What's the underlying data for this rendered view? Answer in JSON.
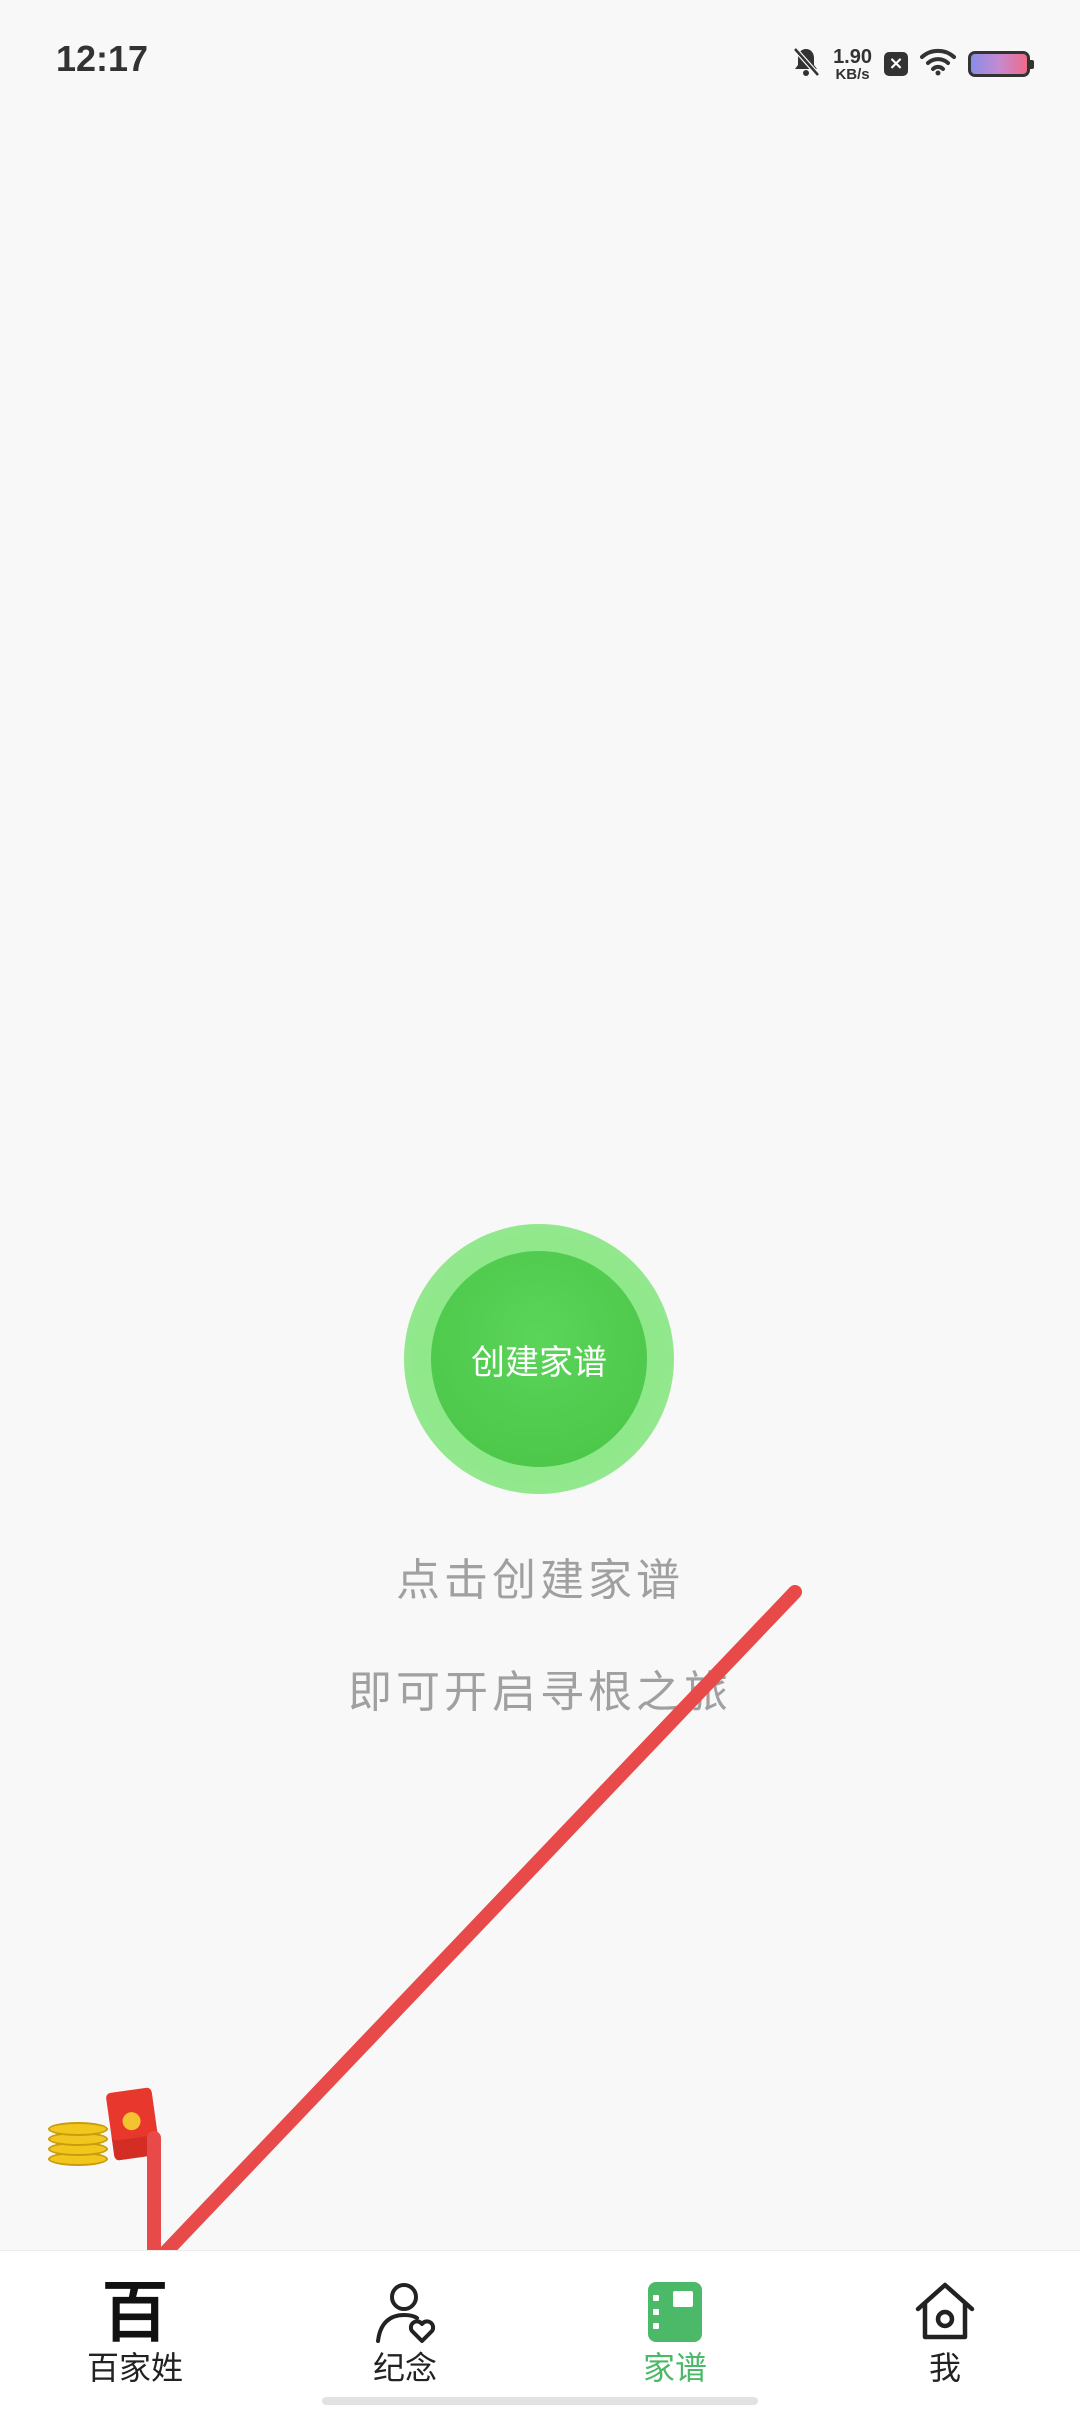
{
  "status_bar": {
    "time": "12:17",
    "net_speed_value": "1.90",
    "net_speed_unit": "KB/s",
    "icons": [
      "bell-off-icon",
      "close-box-icon",
      "wifi-icon",
      "battery-icon"
    ]
  },
  "main": {
    "create_button_label": "创建家谱",
    "hint_line_1": "点击创建家谱",
    "hint_line_2": "即可开启寻根之旅",
    "floating_promo_icons": [
      "coins-icon",
      "red-envelope-icon"
    ]
  },
  "tab_bar": {
    "items": [
      {
        "label": "百家姓",
        "icon_glyph": "百",
        "icon": "bai-character-icon",
        "active": false
      },
      {
        "label": "纪念",
        "icon": "person-heart-icon",
        "active": false
      },
      {
        "label": "家谱",
        "icon": "book-icon",
        "active": true
      },
      {
        "label": "我",
        "icon": "house-icon",
        "active": false
      }
    ]
  },
  "colors": {
    "accent_green": "#4ec94b",
    "active_tab_green": "#4cb968",
    "hint_gray": "#a0a0a0",
    "annotation_arrow_red": "#e84a4a"
  }
}
